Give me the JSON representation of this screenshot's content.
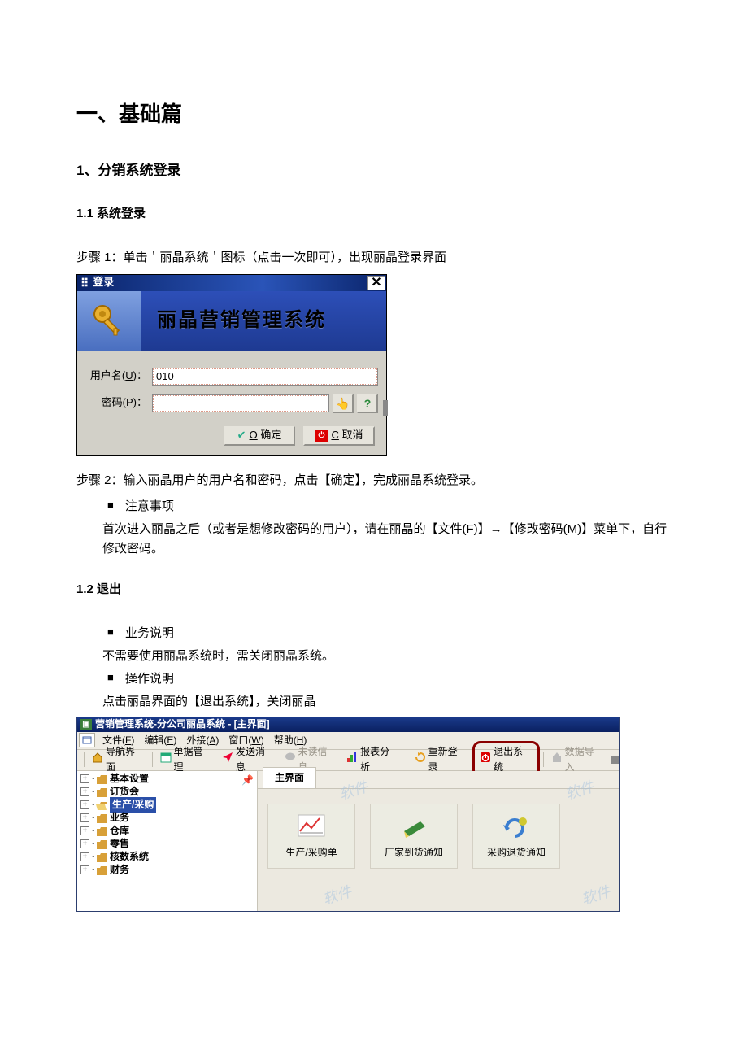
{
  "doc": {
    "h1": "一、基础篇",
    "h2_1": "1、分销系统登录",
    "h3_11": "1.1 系统登录",
    "step1": "步骤 1：单击＇丽晶系统＇图标（点击一次即可），出现丽晶登录界面",
    "step2": "步骤 2：输入丽晶用户的用户名和密码，点击【确定】，完成丽晶系统登录。",
    "note_label": "注意事项",
    "note_body": "首次进入丽晶之后（或者是想修改密码的用户），请在丽晶的【文件(F)】→【修改密码(M)】菜单下，自行修改密码。",
    "h3_12": "1.2 退出",
    "biz_label": "业务说明",
    "biz_body": "不需要使用丽晶系统时，需关闭丽晶系统。",
    "op_label": "操作说明",
    "op_body": "点击丽晶界面的【退出系统】，关闭丽晶"
  },
  "login": {
    "title": "登录",
    "banner": "丽晶营销管理系统",
    "user_label": "用户名(U)：",
    "user_value": "010",
    "pwd_label": "密码(P)：",
    "ok_label_accel": "O",
    "ok_label": " 确定",
    "cancel_label_accel": "C",
    "cancel_label": " 取消"
  },
  "app": {
    "title": "营销管理系统-分公司丽晶系统 - [主界面]",
    "menus": {
      "file": "文件(F)",
      "edit": "编辑(E)",
      "plugin": "外接(A)",
      "window": "窗口(W)",
      "help": "帮助(H)"
    },
    "toolbar": {
      "nav": "导航界面",
      "bill": "单据管理",
      "send": "发送消息",
      "unread": "未读信息",
      "report": "报表分析",
      "relogin": "重新登录",
      "exit": "退出系统",
      "import": "数据导入"
    },
    "tree": {
      "items": [
        {
          "label": "基本设置",
          "open": false
        },
        {
          "label": "订货会",
          "open": false
        },
        {
          "label": "生产/采购",
          "open": true,
          "selected": true
        },
        {
          "label": "业务",
          "open": false
        },
        {
          "label": "仓库",
          "open": false
        },
        {
          "label": "零售",
          "open": false
        },
        {
          "label": "核数系统",
          "open": false
        },
        {
          "label": "财务",
          "open": false
        }
      ]
    },
    "main_tab": "主界面",
    "buttons": {
      "purchase": "生产/采购单",
      "arrival": "厂家到货通知",
      "return": "采购退货通知"
    },
    "watermark": "软件"
  }
}
